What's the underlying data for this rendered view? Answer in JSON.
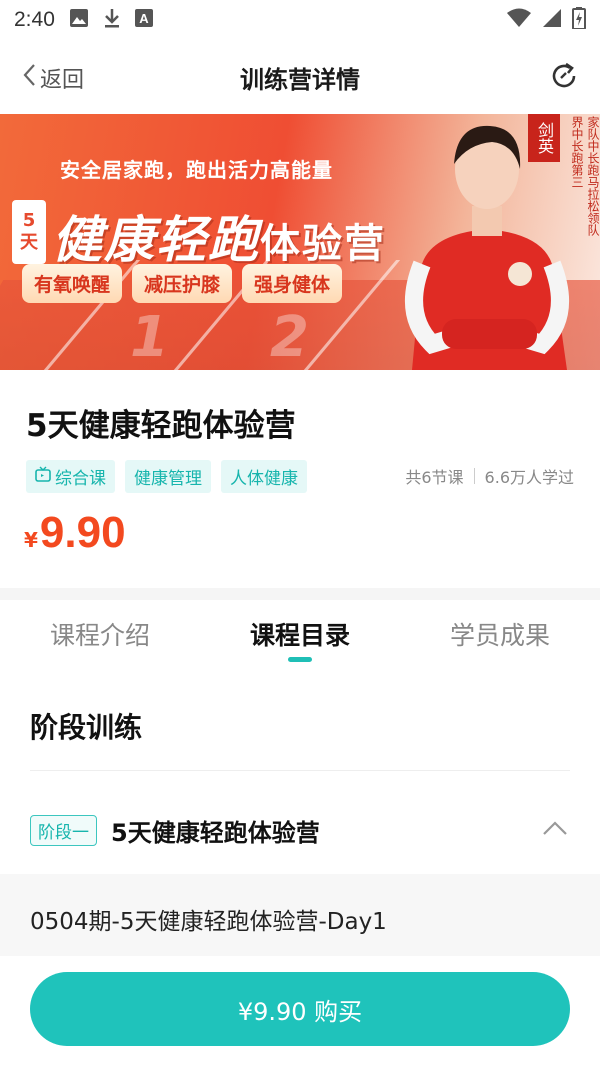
{
  "status_bar": {
    "time": "2:40"
  },
  "nav": {
    "back_label": "返回",
    "title": "训练营详情"
  },
  "banner": {
    "slogan": "安全居家跑，跑出活力高能量",
    "days_badge_top": "5",
    "days_badge_bottom": "天",
    "big_title": "健康轻跑",
    "big_title_suffix": "体验营",
    "chips": [
      "有氧唤醒",
      "减压护膝",
      "强身健体"
    ],
    "coach_name": "剑英",
    "coach_title_col1": "界中长跑第三",
    "coach_title_col2": "家队中长跑马拉松领队",
    "track_numbers": [
      "1",
      "2"
    ]
  },
  "course": {
    "title": "5天健康轻跑体验营",
    "tags": [
      {
        "label": "综合课",
        "icon": "tv-icon"
      },
      {
        "label": "健康管理"
      },
      {
        "label": "人体健康"
      }
    ],
    "lessons_count": "共6节课",
    "learners": "6.6万人学过",
    "price_symbol": "¥",
    "price": "9.90"
  },
  "tabs": [
    {
      "label": "课程介绍",
      "active": false
    },
    {
      "label": "课程目录",
      "active": true
    },
    {
      "label": "学员成果",
      "active": false
    }
  ],
  "catalog": {
    "section_title": "阶段训练",
    "stage_badge": "阶段一",
    "stage_name": "5天健康轻跑体验营",
    "lessons": [
      "0504期-5天健康轻跑体验营-Day1"
    ]
  },
  "buy_button": "¥9.90 购买",
  "colors": {
    "accent": "#1fc3bb",
    "price": "#f3491f",
    "banner": "#ef4e33"
  }
}
